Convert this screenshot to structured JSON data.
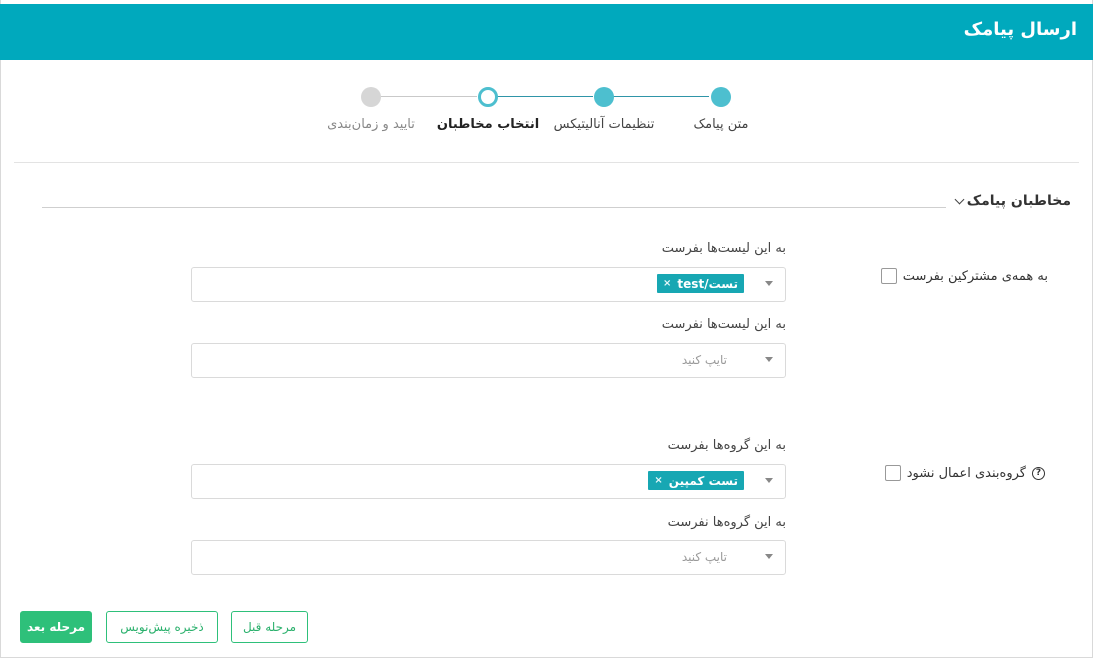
{
  "header": {
    "title": "ارسال پیامک"
  },
  "stepper": {
    "steps": [
      {
        "label": "متن پیامک",
        "state": "done"
      },
      {
        "label": "تنظیمات آنالیتیکس",
        "state": "done"
      },
      {
        "label": "انتخاب مخاطبان",
        "state": "active"
      },
      {
        "label": "تایید و زمان‌بندی",
        "state": "pending"
      }
    ]
  },
  "section": {
    "title": "مخاطبان پیامک"
  },
  "lists": {
    "all_subscribers_label": "به همه‌ی مشترکین بفرست",
    "send_label": "به این لیست‌ها بفرست",
    "send_tag": "تست/test",
    "send_tag_remove": "×",
    "exclude_label": "به این لیست‌ها نفرست",
    "exclude_placeholder": "تایپ کنید"
  },
  "groups": {
    "no_grouping_label": "گروه‌بندی اعمال نشود",
    "help_glyph": "?",
    "send_label": "به این گروه‌ها بفرست",
    "send_tag": "تست کمپین",
    "send_tag_remove": "×",
    "exclude_label": "به این گروه‌ها نفرست",
    "exclude_placeholder": "تایپ کنید"
  },
  "actions": {
    "next": "مرحله بعد",
    "save_draft": "ذخیره پیش‌نویس",
    "previous": "مرحله قبل"
  },
  "colors": {
    "header": "#00a9bd",
    "step": "#4dbfcf",
    "tag": "#17a7b3",
    "primary": "#2ec07a"
  }
}
